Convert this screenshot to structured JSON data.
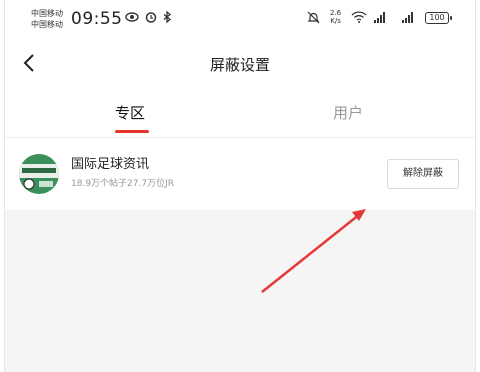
{
  "status_bar": {
    "carrier1": "中国移动",
    "carrier2": "中国移动",
    "time": "09:55",
    "net_speed_value": "2.6",
    "net_speed_unit": "K/s",
    "battery": "100"
  },
  "header": {
    "title": "屏蔽设置"
  },
  "tabs": [
    {
      "label": "专区",
      "active": true
    },
    {
      "label": "用户",
      "active": false
    }
  ],
  "blocked_items": [
    {
      "name": "国际足球资讯",
      "meta": "18.9万个帖子27.7万位JR",
      "action_label": "解除屏蔽"
    }
  ],
  "colors": {
    "accent": "#e8352b",
    "background_gray": "#f5f5f5"
  }
}
